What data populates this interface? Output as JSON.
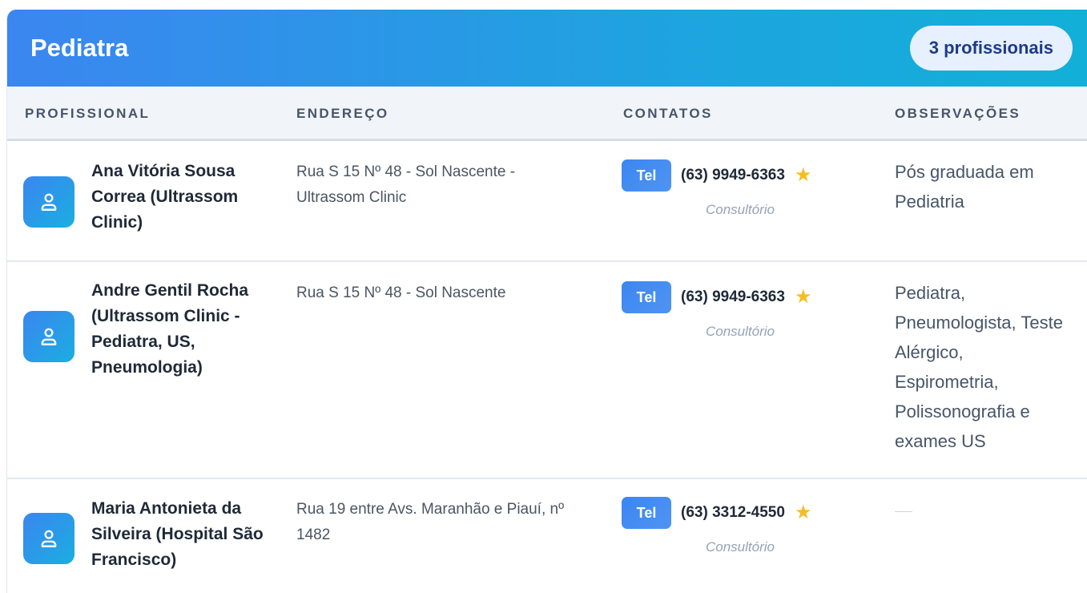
{
  "header": {
    "title": "Pediatra",
    "count_badge": "3 profissionais"
  },
  "columns": {
    "profissional": "PROFISSIONAL",
    "endereco": "ENDEREÇO",
    "contatos": "CONTATOS",
    "observacoes": "OBSERVAÇÕES"
  },
  "rows": [
    {
      "name": "Ana Vitória Sousa Correa (Ultrassom Clinic)",
      "address": "Rua S 15 Nº 48 - Sol Nascente - Ultrassom Clinic",
      "contact": {
        "badge": "Tel",
        "phone": "(63) 9949-6363",
        "star": "★",
        "type": "Consultório"
      },
      "notes": "Pós graduada em Pediatria"
    },
    {
      "name": "Andre Gentil Rocha (Ultrassom Clinic - Pediatra, US, Pneumologia)",
      "address": "Rua S 15 Nº 48 - Sol Nascente",
      "contact": {
        "badge": "Tel",
        "phone": "(63) 9949-6363",
        "star": "★",
        "type": "Consultório"
      },
      "notes": "Pediatra, Pneumologista, Teste Alérgico, Espirometria, Polissonografia e exames US"
    },
    {
      "name": "Maria Antonieta da Silveira (Hospital São Francisco)",
      "address": "Rua 19 entre Avs. Maranhão e Piauí, nº 1482",
      "contact": {
        "badge": "Tel",
        "phone": "(63) 3312-4550",
        "star": "★",
        "type": "Consultório"
      },
      "notes": ""
    }
  ],
  "colors": {
    "header_gradient_start": "#3b86f0",
    "header_gradient_end": "#12b0d8",
    "badge_bg": "#e6f0fe",
    "star": "#f5bd1f"
  },
  "icons": {
    "avatar": "user-icon",
    "favorite": "star-icon"
  }
}
